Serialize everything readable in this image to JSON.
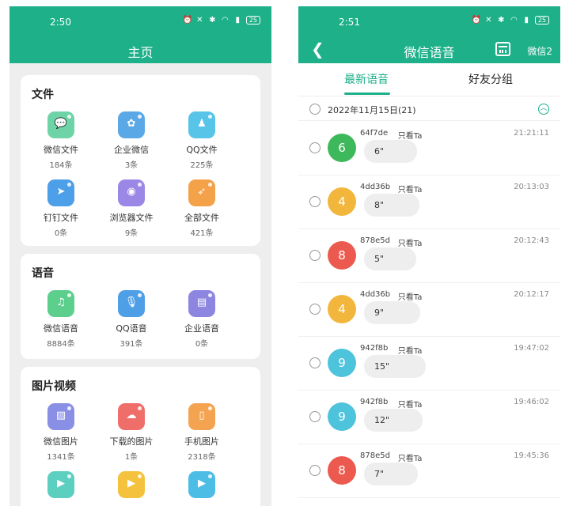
{
  "left": {
    "status": {
      "time": "2:50",
      "battery": "25"
    },
    "title": "主页",
    "sections": [
      {
        "title": "文件",
        "items": [
          {
            "label": "微信文件",
            "count": "184条",
            "icon": "wechat-chat-icon",
            "color": "#6fd3a8",
            "glyph": "💬"
          },
          {
            "label": "企业微信",
            "count": "3条",
            "icon": "wecom-icon",
            "color": "#5aa9e6",
            "glyph": "✿"
          },
          {
            "label": "QQ文件",
            "count": "225条",
            "icon": "qq-icon",
            "color": "#57c4e8",
            "glyph": "♟"
          },
          {
            "label": "钉钉文件",
            "count": "0条",
            "icon": "dingtalk-icon",
            "color": "#4c9fe8",
            "glyph": "➤"
          },
          {
            "label": "浏览器文件",
            "count": "9条",
            "icon": "browser-globe-icon",
            "color": "#9b87e6",
            "glyph": "◉"
          },
          {
            "label": "全部文件",
            "count": "421条",
            "icon": "all-files-icon",
            "color": "#f3a24a",
            "glyph": "➶"
          }
        ]
      },
      {
        "title": "语音",
        "items": [
          {
            "label": "微信语音",
            "count": "8884条",
            "icon": "music-note-icon",
            "color": "#5ccf8d",
            "glyph": "♫"
          },
          {
            "label": "QQ语音",
            "count": "391条",
            "icon": "microphone-icon",
            "color": "#4f9fe6",
            "glyph": "🎙"
          },
          {
            "label": "企业语音",
            "count": "0条",
            "icon": "wecom-voice-icon",
            "color": "#8c86e0",
            "glyph": "▤"
          }
        ]
      },
      {
        "title": "图片视频",
        "items": [
          {
            "label": "微信图片",
            "count": "1341条",
            "icon": "image-icon",
            "color": "#8a8fe6",
            "glyph": "▨"
          },
          {
            "label": "下载的图片",
            "count": "1条",
            "icon": "download-cloud-icon",
            "color": "#f06e6a",
            "glyph": "☁"
          },
          {
            "label": "手机图片",
            "count": "2318条",
            "icon": "phone-image-icon",
            "color": "#f4a350",
            "glyph": "▯"
          },
          {
            "label": "",
            "count": "",
            "icon": "wechat-video-icon",
            "color": "#5ccfc0",
            "glyph": "▶"
          },
          {
            "label": "",
            "count": "",
            "icon": "downloaded-video-icon",
            "color": "#f4c23c",
            "glyph": "▶"
          },
          {
            "label": "",
            "count": "",
            "icon": "phone-video-icon",
            "color": "#4ebde6",
            "glyph": "▶"
          }
        ]
      }
    ]
  },
  "right": {
    "status": {
      "time": "2:51",
      "battery": "25"
    },
    "title": "微信语音",
    "right_label": "微信2",
    "tabs": [
      "最新语音",
      "好友分组"
    ],
    "date_group": "2022年11月15日(21)",
    "filter_label": "只看Ta",
    "messages": [
      {
        "avatar": "6",
        "color": "#3db85a",
        "sender": "64f7de",
        "time": "21:21:11",
        "duration": "6\""
      },
      {
        "avatar": "4",
        "color": "#f2b63c",
        "sender": "4dd36b",
        "time": "20:13:03",
        "duration": "8\""
      },
      {
        "avatar": "8",
        "color": "#ec5a4f",
        "sender": "878e5d",
        "time": "20:12:43",
        "duration": "5\""
      },
      {
        "avatar": "4",
        "color": "#f2b63c",
        "sender": "4dd36b",
        "time": "20:12:17",
        "duration": "9\""
      },
      {
        "avatar": "9",
        "color": "#4ec3dc",
        "sender": "942f8b",
        "time": "19:47:02",
        "duration": "15\""
      },
      {
        "avatar": "9",
        "color": "#4ec3dc",
        "sender": "942f8b",
        "time": "19:46:02",
        "duration": "12\""
      },
      {
        "avatar": "8",
        "color": "#ec5a4f",
        "sender": "878e5d",
        "time": "19:45:36",
        "duration": "7\""
      }
    ]
  },
  "colors": {
    "accent": "#1db089",
    "background": "#eeeeee"
  }
}
